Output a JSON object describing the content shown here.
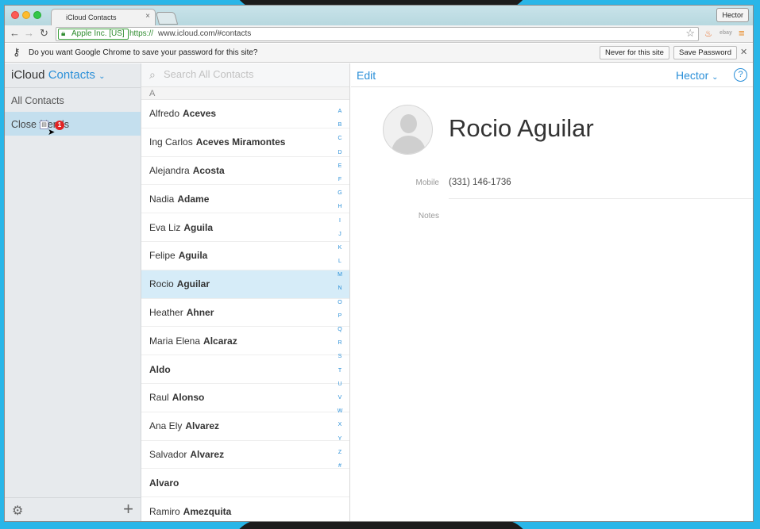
{
  "browser": {
    "tab_title": "iCloud Contacts",
    "profile_name": "Hector",
    "ev_label": "Apple Inc. [US]",
    "url_scheme": "https://",
    "url_rest": "www.icloud.com/#contacts"
  },
  "password_bar": {
    "message": "Do you want Google Chrome to save your password for this site?",
    "never_label": "Never for this site",
    "save_label": "Save Password"
  },
  "sidebar": {
    "brand_icloud": "iCloud",
    "brand_contacts": "Contacts",
    "groups": [
      "All Contacts",
      "Close friends"
    ],
    "drag_badge": "1"
  },
  "list": {
    "search_placeholder": "Search All Contacts",
    "section": "A",
    "contacts": [
      {
        "first": "Alfredo",
        "last": "Aceves"
      },
      {
        "first": "Ing Carlos",
        "last": "Aceves Miramontes"
      },
      {
        "first": "Alejandra",
        "last": "Acosta"
      },
      {
        "first": "Nadia",
        "last": "Adame"
      },
      {
        "first": "Eva Liz",
        "last": "Aguila"
      },
      {
        "first": "Felipe",
        "last": "Aguila"
      },
      {
        "first": "Rocio",
        "last": "Aguilar"
      },
      {
        "first": "Heather",
        "last": "Ahner"
      },
      {
        "first": "Maria Elena",
        "last": "Alcaraz"
      },
      {
        "first": "",
        "last": "Aldo"
      },
      {
        "first": "Raul",
        "last": "Alonso"
      },
      {
        "first": "Ana Ely",
        "last": "Alvarez"
      },
      {
        "first": "Salvador",
        "last": "Alvarez"
      },
      {
        "first": "",
        "last": "Alvaro"
      },
      {
        "first": "Ramiro",
        "last": "Amezquita"
      }
    ],
    "selected_index": 6,
    "alphabet": [
      "A",
      "B",
      "C",
      "D",
      "E",
      "F",
      "G",
      "H",
      "I",
      "J",
      "K",
      "L",
      "M",
      "N",
      "O",
      "P",
      "Q",
      "R",
      "S",
      "T",
      "U",
      "V",
      "W",
      "X",
      "Y",
      "Z",
      "#"
    ]
  },
  "detail": {
    "edit_label": "Edit",
    "user_label": "Hector",
    "help_label": "?",
    "full_name": "Rocio Aguilar",
    "mobile_label": "Mobile",
    "mobile_value": "(331) 146-1736",
    "notes_label": "Notes"
  },
  "colors": {
    "accent": "#2a8fd8",
    "selected_row": "#d6ecf8",
    "desktop": "#29b6e8"
  }
}
